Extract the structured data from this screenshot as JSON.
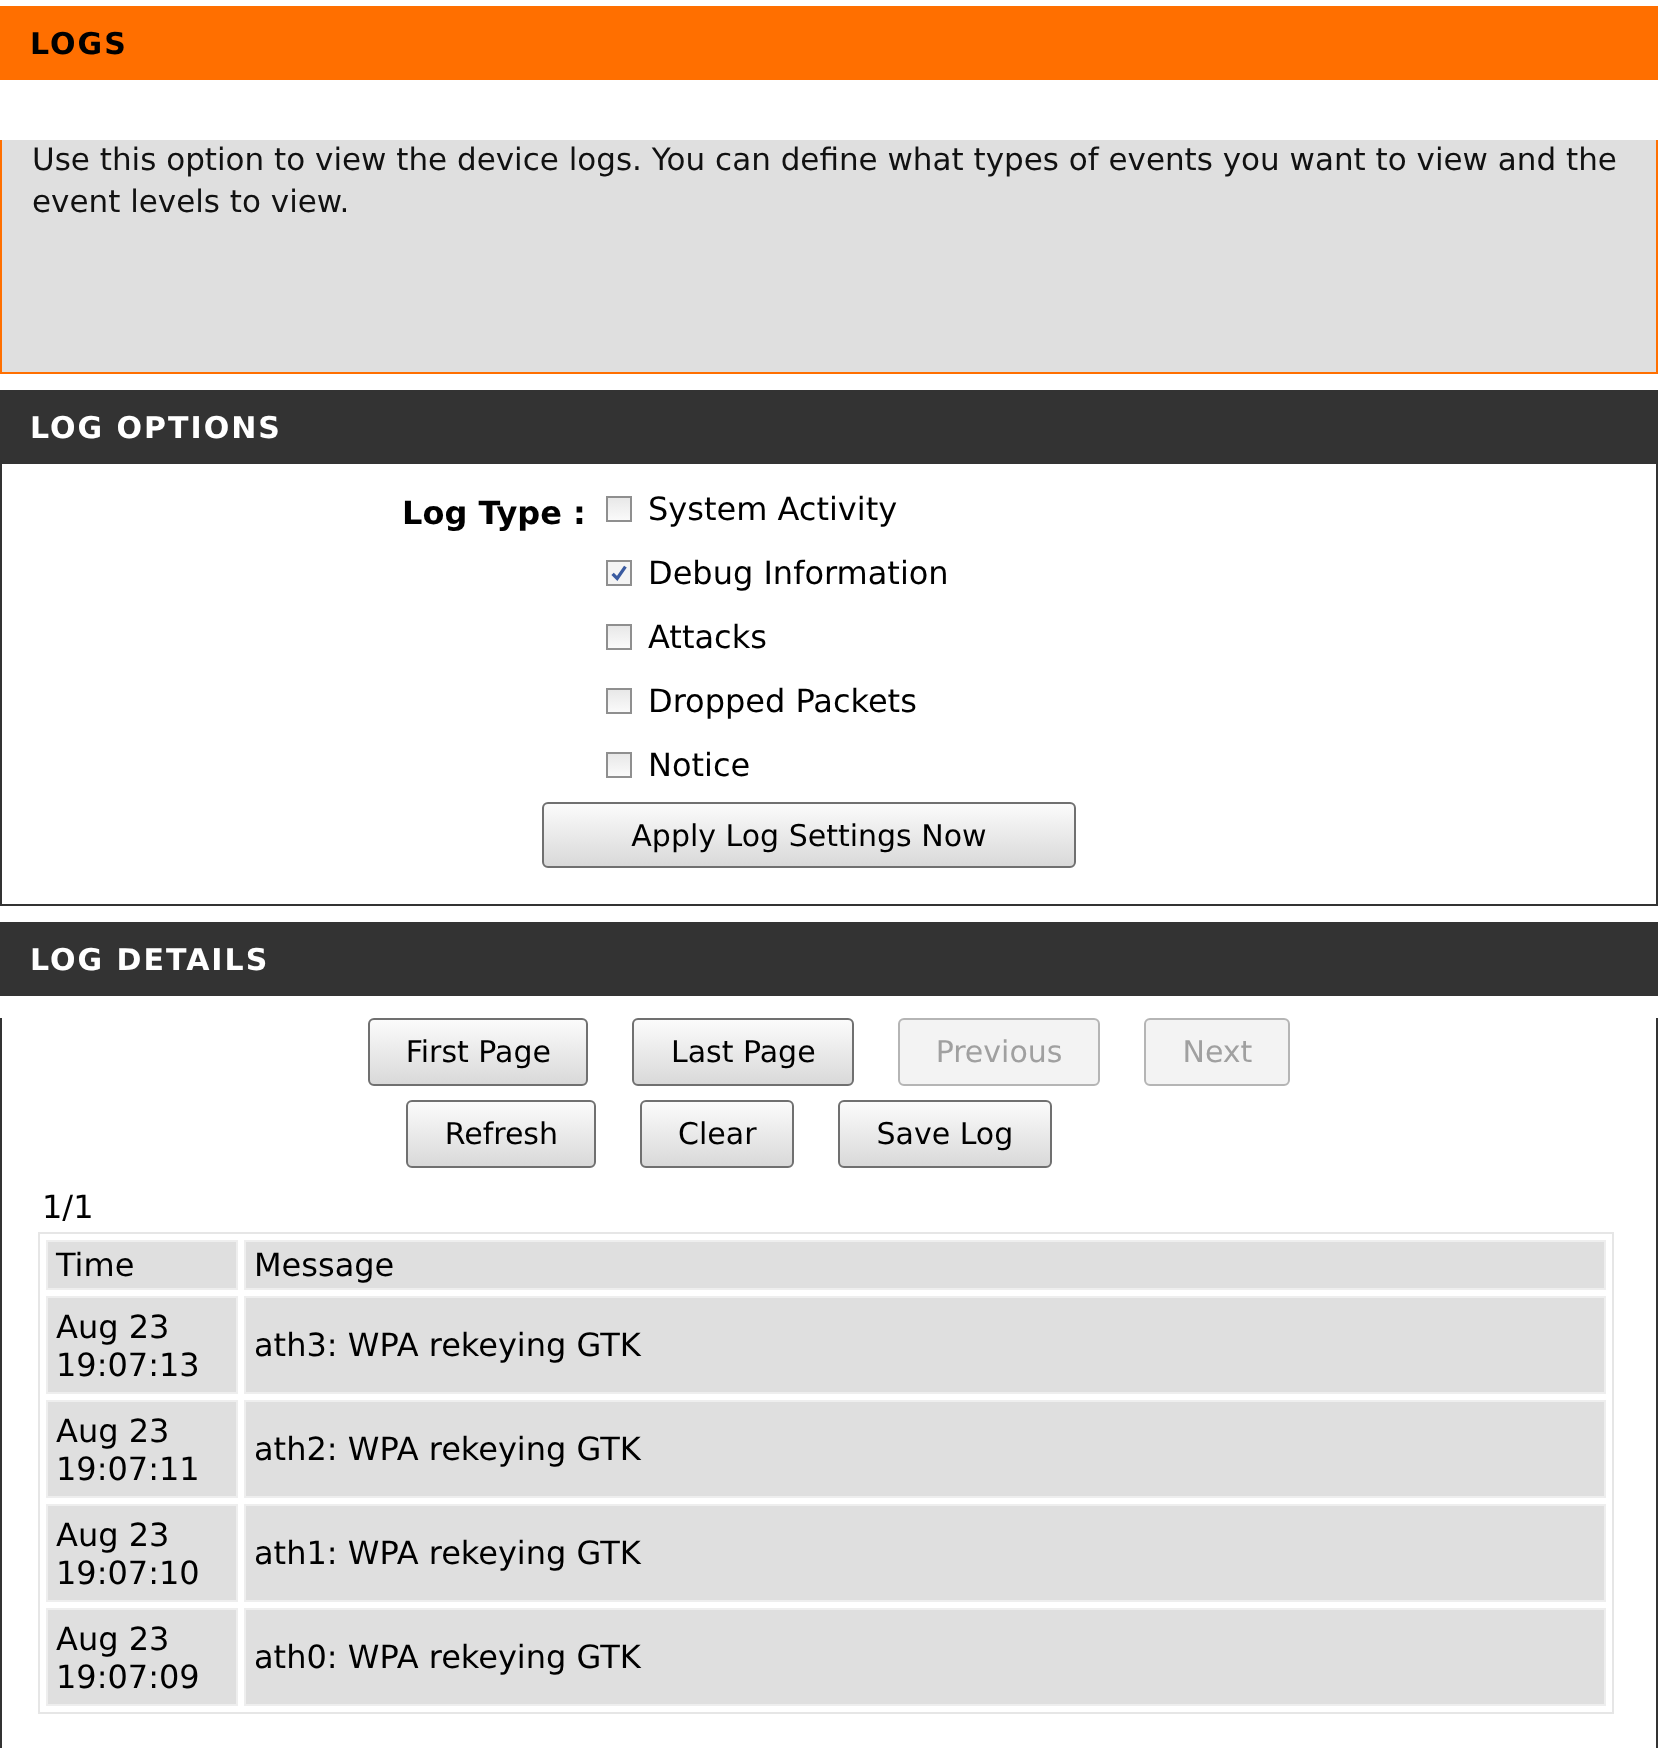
{
  "logs": {
    "title": "LOGS",
    "description": "Use this option to view the device logs. You can define what types of events you want to view and the event levels to view."
  },
  "log_options": {
    "title": "LOG OPTIONS",
    "log_type_label": "Log Type :",
    "log_types": [
      {
        "label": "System Activity",
        "checked": false
      },
      {
        "label": "Debug Information",
        "checked": true
      },
      {
        "label": "Attacks",
        "checked": false
      },
      {
        "label": "Dropped Packets",
        "checked": false
      },
      {
        "label": "Notice",
        "checked": false
      }
    ],
    "apply_button": "Apply Log Settings Now"
  },
  "log_details": {
    "title": "LOG DETAILS",
    "button_rows": [
      [
        {
          "label": "First Page",
          "disabled": false
        },
        {
          "label": "Last Page",
          "disabled": false
        },
        {
          "label": "Previous",
          "disabled": true
        },
        {
          "label": "Next",
          "disabled": true
        }
      ],
      [
        {
          "label": "Refresh",
          "disabled": false
        },
        {
          "label": "Clear",
          "disabled": false
        },
        {
          "label": "Save Log",
          "disabled": false
        }
      ]
    ],
    "page_indicator": "1/1",
    "table": {
      "columns": [
        "Time",
        "Message"
      ],
      "rows": [
        [
          "Aug 23 19:07:13",
          "ath3: WPA rekeying GTK"
        ],
        [
          "Aug 23 19:07:11",
          "ath2: WPA rekeying GTK"
        ],
        [
          "Aug 23 19:07:10",
          "ath1: WPA rekeying GTK"
        ],
        [
          "Aug 23 19:07:09",
          "ath0: WPA rekeying GTK"
        ]
      ]
    }
  }
}
